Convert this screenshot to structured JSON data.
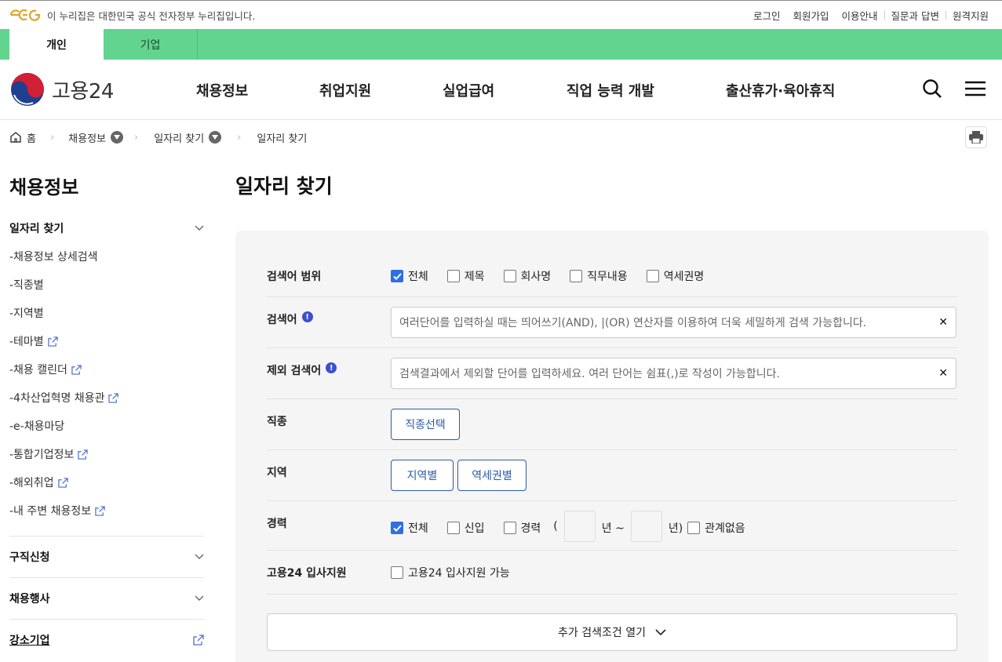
{
  "gov_bar": {
    "notice": "이 누리집은 대한민국 공식 전자정부 누리집입니다.",
    "links": [
      "로그인",
      "회원가입",
      "이용안내",
      "질문과 답변",
      "원격지원"
    ]
  },
  "tabs": [
    "개인",
    "기업"
  ],
  "header": {
    "logo_text": "고용24",
    "nav": [
      "채용정보",
      "취업지원",
      "실업급여",
      "직업 능력 개발",
      "출산휴가·육아휴직"
    ]
  },
  "breadcrumb": [
    "홈",
    "채용정보",
    "일자리 찾기",
    "일자리 찾기"
  ],
  "sidebar": {
    "title": "채용정보",
    "group": "일자리 찾기",
    "items": [
      {
        "label": "-채용정보 상세검색",
        "ext": false
      },
      {
        "label": "-직종별",
        "ext": false
      },
      {
        "label": "-지역별",
        "ext": false
      },
      {
        "label": "-테마별",
        "ext": true
      },
      {
        "label": "-채용 캘린더",
        "ext": true
      },
      {
        "label": "-4차산업혁명 채용관",
        "ext": true
      },
      {
        "label": "-e-채용마당",
        "ext": false
      },
      {
        "label": "-통합기업정보",
        "ext": true
      },
      {
        "label": "-해외취업",
        "ext": true
      },
      {
        "label": "-내 주변 채용정보",
        "ext": true
      }
    ],
    "sections": [
      "구직신청",
      "채용행사",
      "강소기업"
    ]
  },
  "main": {
    "title": "일자리 찾기",
    "scope": {
      "label": "검색어 범위",
      "options": [
        {
          "label": "전체",
          "checked": true
        },
        {
          "label": "제목",
          "checked": false
        },
        {
          "label": "회사명",
          "checked": false
        },
        {
          "label": "직무내용",
          "checked": false
        },
        {
          "label": "역세권명",
          "checked": false
        }
      ]
    },
    "keyword": {
      "label": "검색어",
      "placeholder": "여러단어를 입력하실 때는 띄어쓰기(AND), |(OR) 연산자를 이용하여 더욱 세밀하게 검색 가능합니다."
    },
    "exclude": {
      "label": "제외 검색어",
      "placeholder": "검색결과에서 제외할 단어를 입력하세요. 여러 단어는 쉼표(,)로 작성이 가능합니다."
    },
    "job": {
      "label": "직종",
      "button": "직종선택"
    },
    "region": {
      "label": "지역",
      "buttons": [
        "지역별",
        "역세권별"
      ]
    },
    "career": {
      "label": "경력",
      "options": [
        {
          "label": "전체",
          "checked": true
        },
        {
          "label": "신입",
          "checked": false
        },
        {
          "label": "경력",
          "checked": false
        }
      ],
      "open_paren": "(",
      "year_from": "년 ~",
      "year_to": "년)",
      "none": "관계없음"
    },
    "apply": {
      "label": "고용24 입사지원",
      "option": "고용24 입사지원 가능"
    },
    "more": "추가 검색조건 열기"
  }
}
